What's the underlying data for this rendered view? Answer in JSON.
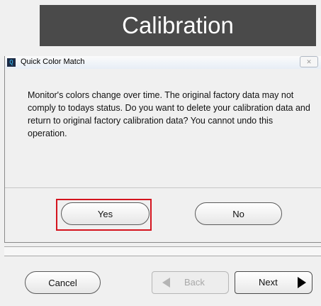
{
  "banner": {
    "title": "Calibration"
  },
  "dialog": {
    "app_icon": "Q",
    "title": "Quick Color Match",
    "close_icon": "✕",
    "message": "Monitor's colors change over time. The original factory data may not comply to todays status. Do you want to delete your calibration data and return to original factory calibration data? You cannot undo this operation.",
    "yes_label": "Yes",
    "no_label": "No"
  },
  "wizard": {
    "cancel_label": "Cancel",
    "back_label": "Back",
    "next_label": "Next"
  },
  "icons": {
    "back": "left-triangle-icon",
    "next": "right-triangle-icon"
  },
  "colors": {
    "banner_bg": "#4a4a4a",
    "highlight": "#d4141e"
  }
}
